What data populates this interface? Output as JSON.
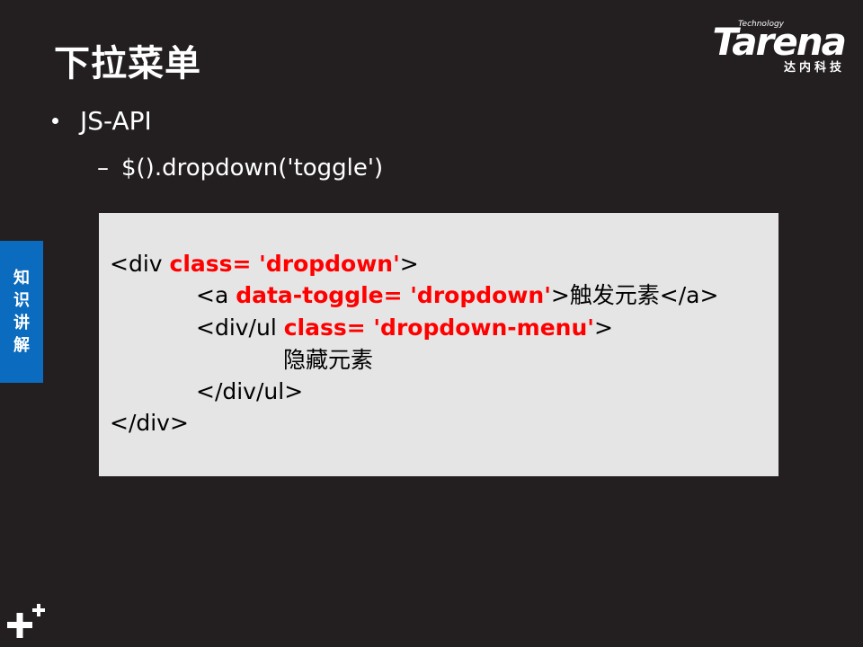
{
  "slide": {
    "title": "下拉菜单",
    "bullet_main": "JS-API",
    "bullet_sub_dash": "–",
    "bullet_sub": "$().dropdown('toggle')",
    "side_tab": [
      "知",
      "识",
      "讲",
      "解"
    ]
  },
  "logo": {
    "technology": "Technology",
    "word": "Tarena",
    "subtitle": "达内科技"
  },
  "code": {
    "line1_a": "<div ",
    "line1_b": "class= 'dropdown'",
    "line1_c": ">",
    "line2_a": "<a ",
    "line2_b": "data-toggle= 'dropdown'",
    "line2_c": ">触发元素</a>",
    "line3_a": "<div/ul ",
    "line3_b": "class= 'dropdown-menu'",
    "line3_c": ">",
    "line4": "隐藏元素",
    "line5": "</div/ul>",
    "line6": "</div>"
  },
  "colors": {
    "background": "#231f20",
    "code_background": "#e5e5e5",
    "highlight": "#ff0000",
    "side_tab": "#0b6bbf"
  },
  "icons": {
    "bottom_left": "plus-plus-icon",
    "bullet": "bullet-dot-icon"
  }
}
